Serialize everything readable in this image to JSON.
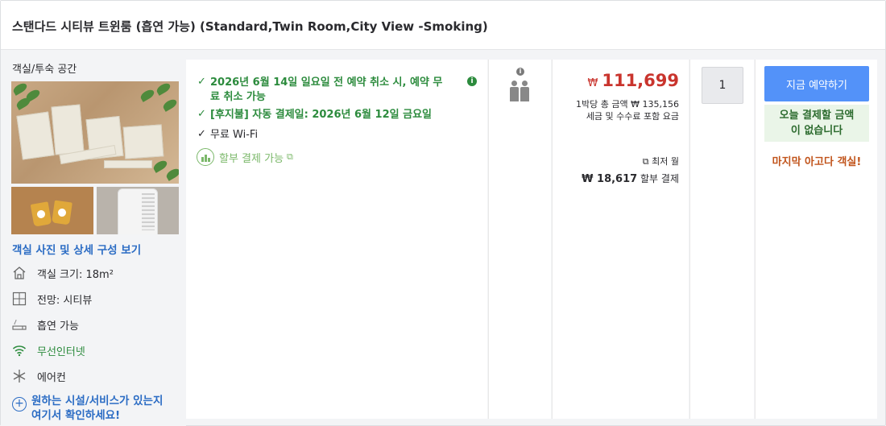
{
  "room": {
    "title": "스탠다드 시티뷰 트윈룸 (흡연 가능) (Standard,Twin Room,City View -Smoking)"
  },
  "left": {
    "section_label": "객실/투숙 공간",
    "gallery_link": "객실 사진 및 상세 구성 보기",
    "features": [
      {
        "icon": "house-icon",
        "label": "객실 크기: 18m²"
      },
      {
        "icon": "window-icon",
        "label": "전망: 시티뷰"
      },
      {
        "icon": "cigarette-icon",
        "label": "흡연 가능"
      },
      {
        "icon": "wifi-icon",
        "label": "무선인터넷"
      },
      {
        "icon": "snowflake-icon",
        "label": "에어컨"
      }
    ],
    "more_link_line1": "원하는 시설/서비스가 있는지",
    "more_link_line2": "여기서 확인하세요!"
  },
  "benefits": {
    "cancel_line1": "2026년 6월 14일 일요일 전 예약 취소 시, 예약 무",
    "cancel_line2": "료 취소 가능",
    "postpay": "[후지불] 자동 결제일: 2026년 6월 12일 금요일",
    "wifi": "무료 Wi-Fi",
    "installment": "할부 결제 가능"
  },
  "occupancy": {
    "adults": 2
  },
  "price": {
    "currency_symbol": "₩",
    "amount": "111,699",
    "total_line": "1박당 총 금액 ₩ 135,156",
    "taxes_line": "세금 및 수수료 포함 요금",
    "min_month_label": "최저 월",
    "month_amount": "₩ 18,617",
    "month_suffix": "할부 결제"
  },
  "quantity": {
    "value": "1"
  },
  "booking": {
    "button_label": "지금 예약하기",
    "pay_later_line1": "오늘 결제할 금액",
    "pay_later_line2": "이 없습니다",
    "scarcity": "마지막 아고다 객실!"
  },
  "colors": {
    "accent_blue": "#5392f9",
    "price_red": "#c9342d",
    "benefit_green": "#2c8b3d",
    "scarcity_orange": "#c1541b"
  }
}
